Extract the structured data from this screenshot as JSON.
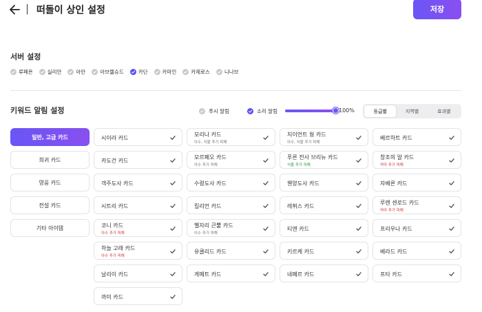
{
  "header": {
    "title": "떠돌이 상인 설정",
    "save_label": "저장"
  },
  "server": {
    "title": "서버 설정",
    "items": [
      {
        "label": "루페온",
        "checked": false
      },
      {
        "label": "실리안",
        "checked": false
      },
      {
        "label": "아만",
        "checked": false
      },
      {
        "label": "아브렐슈드",
        "checked": false
      },
      {
        "label": "카단",
        "checked": true
      },
      {
        "label": "카마인",
        "checked": false
      },
      {
        "label": "카제로스",
        "checked": false
      },
      {
        "label": "니나브",
        "checked": false
      }
    ]
  },
  "keyword": {
    "title": "키워드 알림 설정",
    "push_label": "푸시 알림",
    "push_checked": false,
    "sound_label": "소리 알림",
    "sound_checked": true,
    "volume_percent": 100,
    "volume_text": "100%",
    "tabs": [
      {
        "label": "등급별",
        "active": true
      },
      {
        "label": "지역별",
        "active": false
      },
      {
        "label": "효과별",
        "active": false
      }
    ]
  },
  "categories": [
    {
      "label": "일반, 고급 카드",
      "active": true
    },
    {
      "label": "희귀 카드",
      "active": false
    },
    {
      "label": "영웅 카드",
      "active": false
    },
    {
      "label": "전설 카드",
      "active": false
    },
    {
      "label": "기타 아이템",
      "active": false
    }
  ],
  "cards": [
    [
      {
        "name": "시이라 카드",
        "note": ""
      },
      {
        "name": "카도건 카드",
        "note": ""
      },
      {
        "name": "객주도사 카드",
        "note": ""
      },
      {
        "name": "시트리 카드",
        "note": ""
      },
      {
        "name": "코니 카드",
        "note": "아수 추가 피해",
        "note_color": "#d23c3c"
      },
      {
        "name": "하늘 고래 카드",
        "note": "아수 추가 피해",
        "note_color": "#d23c3c"
      },
      {
        "name": "날리이 카드",
        "note": ""
      },
      {
        "name": "까미 카드",
        "note": ""
      }
    ],
    [
      {
        "name": "모리나 카드",
        "note": "아수, 식물 추가 피해",
        "note_color": "#777777"
      },
      {
        "name": "모르페오 카드",
        "note": "아수 추가 피해",
        "note_color": "#777777"
      },
      {
        "name": "수령도사 카드",
        "note": ""
      },
      {
        "name": "킬리언 카드",
        "note": ""
      },
      {
        "name": "벨자리 큰뿔 카드",
        "note": "아수 추가 피해",
        "note_color": "#777777"
      },
      {
        "name": "유클리드 카드",
        "note": ""
      },
      {
        "name": "게메트 카드",
        "note": ""
      }
    ],
    [
      {
        "name": "지이언트 웜 카드",
        "note": "아수, 식물 추가 피해",
        "note_color": "#777777"
      },
      {
        "name": "푸른 전사 브리뉴 카드",
        "note": "식물 추가 피해",
        "note_color": "#2e9a4a"
      },
      {
        "name": "웬양도사 카드",
        "note": ""
      },
      {
        "name": "레퓌스 카드",
        "note": ""
      },
      {
        "name": "티엔 카드",
        "note": ""
      },
      {
        "name": "키르케 카드",
        "note": ""
      },
      {
        "name": "네페르 카드",
        "note": ""
      }
    ],
    [
      {
        "name": "베르하트 카드",
        "note": ""
      },
      {
        "name": "창조의 알 카드",
        "note": "악마 추가 피해",
        "note_color": "#d23c3c"
      },
      {
        "name": "자베른 카드",
        "note": ""
      },
      {
        "name": "루렌 센로드 카드",
        "note": "악마 추가 피해",
        "note_color": "#d23c3c"
      },
      {
        "name": "프리우나 카드",
        "note": ""
      },
      {
        "name": "베라드 카드",
        "note": ""
      },
      {
        "name": "프타 카드",
        "note": ""
      }
    ]
  ],
  "icons": {
    "back": "arrow-left-icon",
    "check": "check-icon",
    "selected": "check-circle-icon"
  },
  "colors": {
    "accent": "#6a55f5",
    "accent_end": "#8a4ff0",
    "unchecked": "#c8c8cf",
    "note_red": "#d23c3c",
    "note_green": "#2e9a4a"
  }
}
